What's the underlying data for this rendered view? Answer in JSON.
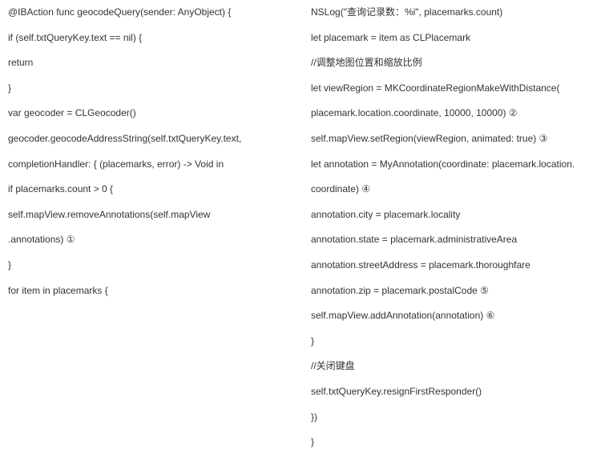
{
  "left": {
    "l0": "@IBAction func geocodeQuery(sender: AnyObject) {",
    "l1": "if (self.txtQueryKey.text == nil) {",
    "l2": "return",
    "l3": "}",
    "l4": "var geocoder = CLGeocoder()",
    "l5": "geocoder.geocodeAddressString(self.txtQueryKey.text,",
    "l6": "completionHandler: { (placemarks, error) -> Void in",
    "l7": "if placemarks.count > 0 {",
    "l8": "self.mapView.removeAnnotations(self.mapView",
    "l9": ".annotations) ①",
    "l10": "}",
    "l11": "for item in placemarks {"
  },
  "right": {
    "r0": "NSLog(\"查询记录数：%i\", placemarks.count)",
    "r1": "let placemark = item as CLPlacemark",
    "r2": "//调整地图位置和缩放比例",
    "r3": "let viewRegion = MKCoordinateRegionMakeWithDistance(",
    "r4": "placemark.location.coordinate, 10000, 10000) ②",
    "r5": "self.mapView.setRegion(viewRegion, animated: true) ③",
    "r6": "let annotation = MyAnnotation(coordinate: placemark.location.",
    "r7": "coordinate) ④",
    "r8": "annotation.city = placemark.locality",
    "r9": "annotation.state = placemark.administrativeArea",
    "r10": "annotation.streetAddress = placemark.thoroughfare",
    "r11": "annotation.zip = placemark.postalCode ⑤",
    "r12": "self.mapView.addAnnotation(annotation) ⑥",
    "r13": "}",
    "r14": "//关闭键盘",
    "r15": "self.txtQueryKey.resignFirstResponder()",
    "r16": "})",
    "r17": "}"
  }
}
